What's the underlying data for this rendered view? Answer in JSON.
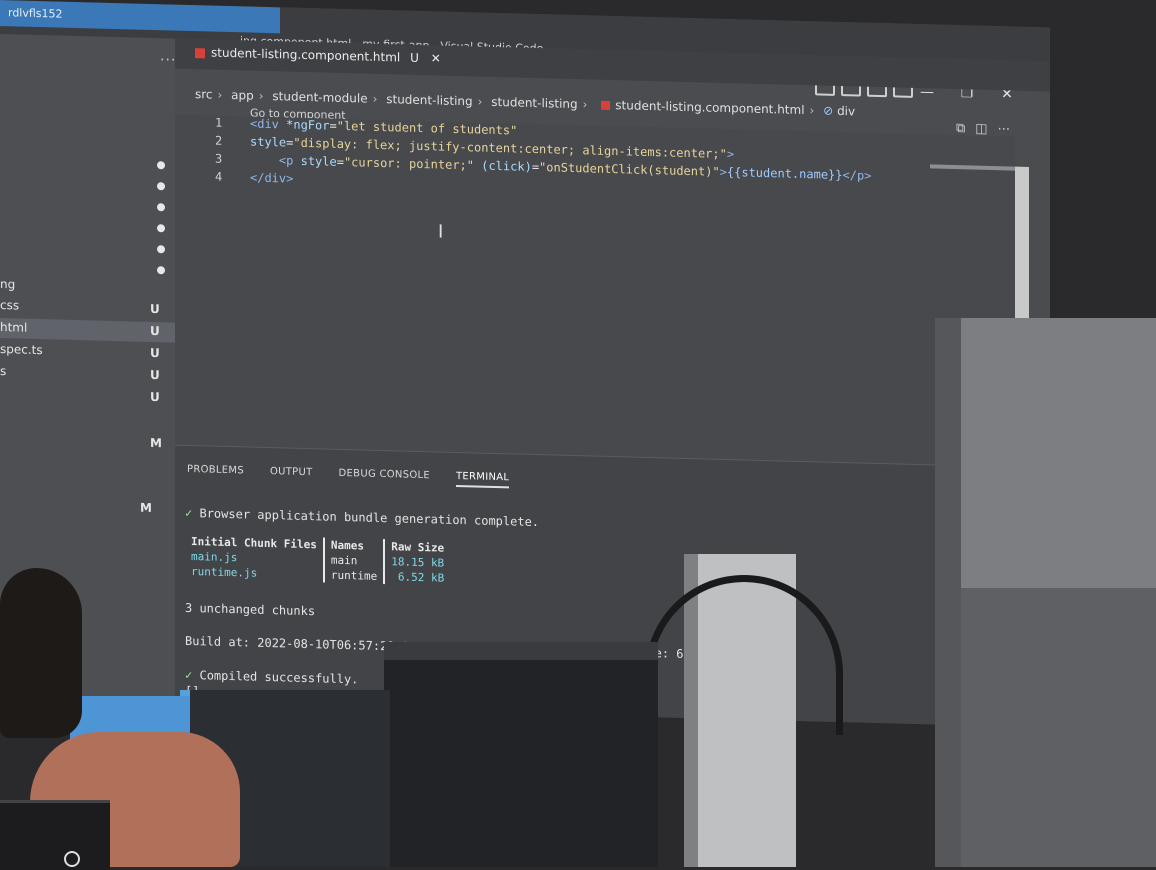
{
  "window": {
    "taskbar_text": "rdlvfls152",
    "title": "ing.component.html - my-first-app - Visual Studio Code",
    "controls": [
      "—",
      "❐",
      "✕"
    ]
  },
  "explorer": {
    "items": [
      {
        "label": "ng",
        "badge": ""
      },
      {
        "label": "css",
        "badge": "U"
      },
      {
        "label": "html",
        "badge": "U"
      },
      {
        "label": "spec.ts",
        "badge": "U"
      },
      {
        "label": "s",
        "badge": "U"
      },
      {
        "label": "",
        "badge": "U"
      },
      {
        "label": "",
        "badge": "M"
      },
      {
        "label": "",
        "badge": "M"
      }
    ]
  },
  "tab": {
    "label": "student-listing.component.html",
    "status": "U",
    "close": "✕"
  },
  "breadcrumb": [
    "src",
    "app",
    "student-module",
    "student-listing",
    "student-listing",
    "student-listing.component.html",
    "div"
  ],
  "goto_label": "Go to component",
  "code": [
    {
      "n": "1",
      "parts": [
        [
          "t",
          "<div "
        ],
        [
          "a",
          "*ngFor"
        ],
        [
          "",
          "="
        ],
        [
          "s",
          "\"let student of students\""
        ]
      ]
    },
    {
      "n": "2",
      "parts": [
        [
          "a",
          "style"
        ],
        [
          "",
          "="
        ],
        [
          "s",
          "\"display: flex; justify-content:center; align-items:center;\""
        ],
        [
          "t",
          ">"
        ]
      ]
    },
    {
      "n": "3",
      "parts": [
        [
          "",
          "    "
        ],
        [
          "t",
          "<p "
        ],
        [
          "a",
          "style"
        ],
        [
          "",
          "="
        ],
        [
          "s",
          "\"cursor: pointer;\" "
        ],
        [
          "a",
          "(click)"
        ],
        [
          "",
          "="
        ],
        [
          "s",
          "\"onStudentClick(student)\""
        ],
        [
          "t",
          ">"
        ],
        [
          "k",
          "{{student.name}}"
        ],
        [
          "t",
          "</p>"
        ]
      ]
    },
    {
      "n": "4",
      "parts": [
        [
          "t",
          "</div>"
        ]
      ]
    }
  ],
  "panel": {
    "tabs": [
      "PROBLEMS",
      "OUTPUT",
      "DEBUG CONSOLE",
      "TERMINAL"
    ],
    "active_tab": "TERMINAL",
    "bundle_msg": "Browser application bundle generation complete.",
    "table": {
      "headers": [
        "Initial Chunk Files",
        "Names",
        "Raw Size"
      ],
      "rows": [
        [
          "main.js",
          "main",
          "18.15 kB"
        ],
        [
          "runtime.js",
          "runtime",
          "6.52 kB"
        ]
      ]
    },
    "unchanged": "3 unchanged chunks",
    "build_line": "Build at: 2022-08-10T06:57:29.094Z - Hash: 4a600e6a07f70ca0 - Time: 68ms",
    "compiled": "Compiled successfully.",
    "prompt": "[]"
  }
}
